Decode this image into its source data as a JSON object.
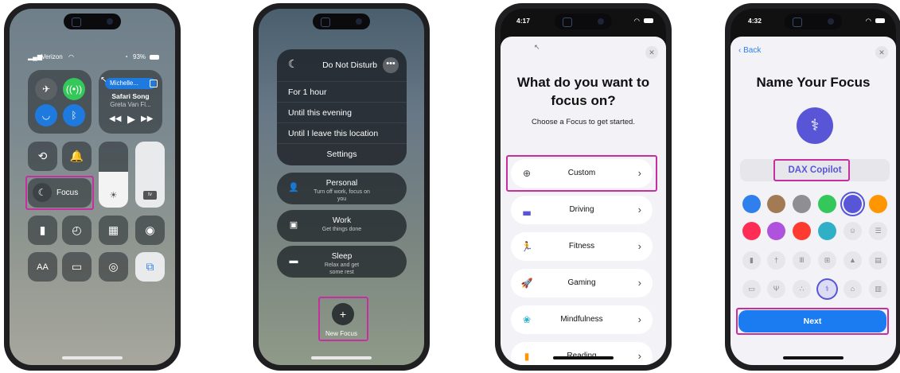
{
  "phone1": {
    "carrier": "Verizon",
    "battery": "93%",
    "music": {
      "source": "Michelle...",
      "song": "Safari Song",
      "artist": "Greta Van Fl..."
    },
    "focus_label": "Focus",
    "aa_label": "AA",
    "atv_label": "tv"
  },
  "phone2": {
    "dnd_title": "Do Not Disturb",
    "options": [
      "For 1 hour",
      "Until this evening",
      "Until I leave this location",
      "Settings"
    ],
    "focuses": [
      {
        "name": "Personal",
        "sub": "Turn off work, focus on you"
      },
      {
        "name": "Work",
        "sub": "Get things done"
      },
      {
        "name": "Sleep",
        "sub": "Relax and get some rest"
      }
    ],
    "new_focus": "New Focus"
  },
  "phone3": {
    "time": "4:17",
    "title": "What do you want to focus on?",
    "subtitle": "Choose a Focus to get started.",
    "options": [
      "Custom",
      "Driving",
      "Fitness",
      "Gaming",
      "Mindfulness",
      "Reading"
    ]
  },
  "phone4": {
    "time": "4:32",
    "back": "Back",
    "title": "Name Your Focus",
    "name_value": "DAX Copilot",
    "next_label": "Next",
    "colors": [
      "#2f80ed",
      "#a27b55",
      "#8e8e93",
      "#34c759",
      "#5856d6",
      "#ff9500",
      "#ff2d55",
      "#af52de",
      "#ff3b30",
      "#30b0c7"
    ],
    "accent": "#5856d6"
  },
  "highlight_color": "#c62fa0"
}
